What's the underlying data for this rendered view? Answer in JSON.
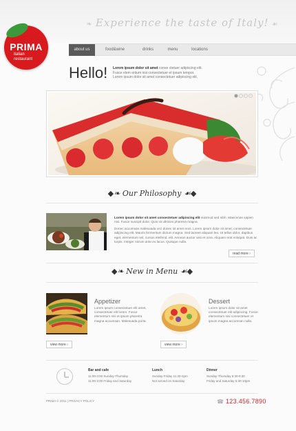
{
  "header": {
    "tagline": "Experience the taste of Italy!"
  },
  "logo": {
    "title": "PRIMA",
    "subtitle_line1": "italian",
    "subtitle_line2": "restaurant"
  },
  "nav": {
    "items": [
      {
        "label": "about us"
      },
      {
        "label": "food&wine"
      },
      {
        "label": "drinks"
      },
      {
        "label": "menu"
      },
      {
        "label": "locations"
      }
    ]
  },
  "intro": {
    "heading": "Hello!",
    "lead": "Lorem ipsum dolor sit amet",
    "lead_rest": " conse ctetuer adipiscing elit. Fusce elem entum nisi consectetuer et ipsum tempor. Lorem ipsum dolor sit amet consectetuer adipiscing elit."
  },
  "slider": {
    "dot_count": 4,
    "active_index": 0
  },
  "philosophy": {
    "title": "Our Philosophy",
    "lead": "Lorem ipsum dolor sit amet consectetuer adipiscing elit",
    "lead_rest": " euismod sed nibh. Maecenas sapien nisi. Fusce suscipit dolor. Quis sit ultricies pharetra magna.",
    "body": "Donec accumsan malesuada orci donec sit amet eros. Lorem ipsum dolor sit amet, consectetuer adipiscing elit. Mauris fermentum dictum magna. Sed laoreet aliquam leo. Ut tellus dolor, dapibus eget, elementum vel, cursus eleifend, elit. Aenean auctor wisi et urna. Aliquam erat volutpat. Duis ac turpis. Integer rutrum ante eu lacus. Quisque nulla.",
    "button": "read more"
  },
  "menu_section": {
    "title": "New in Menu",
    "items": [
      {
        "heading": "Appetizer",
        "text": "Lorem ipsum consectetuer elit amet, consectetuer elit lorem. Fusce elementum nisi et ipsum pharetra magna accumsan. Malesuada porta.",
        "button": "view more"
      },
      {
        "heading": "Dessert",
        "text": "Lorem ipsum dolor sit amet consectetuer elit adipiscing. Fusce elementum nisi consectetuer et ipsum magna accumsan nulla.",
        "button": "view more"
      }
    ]
  },
  "hours": [
    {
      "title": "Bar and cafe",
      "line1": "11:00-3:00 Sunday-Thursday",
      "line2": "11:00-3:00 Friday and Saturday"
    },
    {
      "title": "Lunch",
      "line1": "Sunday-Friday 11:30-2pm",
      "line2": "Not served on Saturday"
    },
    {
      "title": "Dinner",
      "line1": "Sunday-Thursday 5:30-9:30",
      "line2": "Friday and Saturday 5:30-10pm"
    }
  ],
  "footer": {
    "copyright": "PRIMA © 2011",
    "privacy": "PRIVACY POLICY",
    "phone": "123.456.7890"
  },
  "colors": {
    "brand_red": "#d8191e",
    "nav_active": "#5a5a5a",
    "phone_red": "#d0242a"
  }
}
